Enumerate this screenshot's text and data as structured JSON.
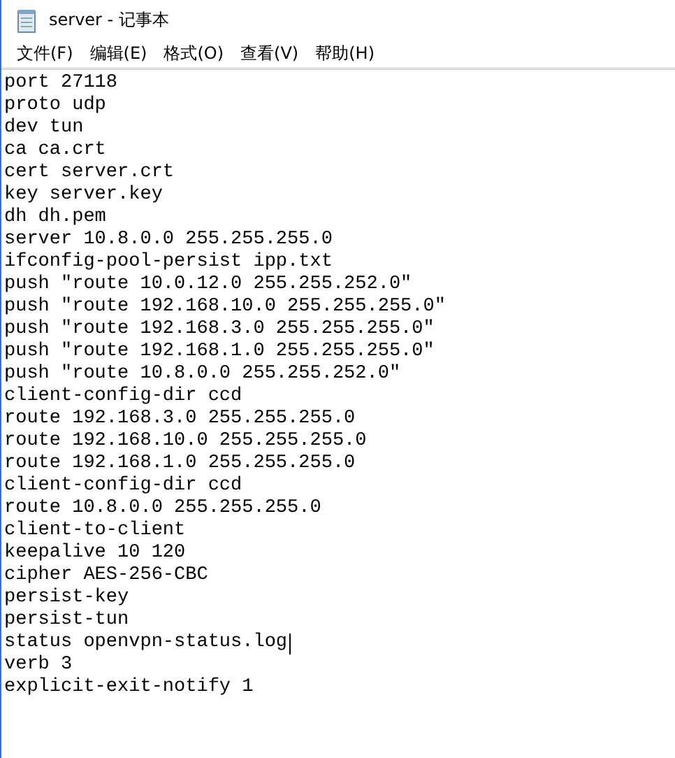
{
  "window": {
    "title": "server - 记事本"
  },
  "menu": [
    "文件(F)",
    "编辑(E)",
    "格式(O)",
    "查看(V)",
    "帮助(H)"
  ],
  "editor": {
    "lines": [
      {
        "text": "port 27118",
        "cursor": false
      },
      {
        "text": "proto udp",
        "cursor": false
      },
      {
        "text": "dev tun",
        "cursor": false
      },
      {
        "text": "ca ca.crt",
        "cursor": false
      },
      {
        "text": "cert server.crt",
        "cursor": false
      },
      {
        "text": "key server.key",
        "cursor": false
      },
      {
        "text": "dh dh.pem",
        "cursor": false
      },
      {
        "text": "server 10.8.0.0 255.255.255.0",
        "cursor": false
      },
      {
        "text": "ifconfig-pool-persist ipp.txt",
        "cursor": false
      },
      {
        "text": "push \"route 10.0.12.0 255.255.252.0\"",
        "cursor": false
      },
      {
        "text": "push \"route 192.168.10.0 255.255.255.0\"",
        "cursor": false
      },
      {
        "text": "push \"route 192.168.3.0 255.255.255.0\"",
        "cursor": false
      },
      {
        "text": "push \"route 192.168.1.0 255.255.255.0\"",
        "cursor": false
      },
      {
        "text": "push \"route 10.8.0.0 255.255.252.0\"",
        "cursor": false
      },
      {
        "text": "client-config-dir ccd",
        "cursor": false
      },
      {
        "text": "route 192.168.3.0 255.255.255.0",
        "cursor": false
      },
      {
        "text": "route 192.168.10.0 255.255.255.0",
        "cursor": false
      },
      {
        "text": "route 192.168.1.0 255.255.255.0",
        "cursor": false
      },
      {
        "text": "client-config-dir ccd",
        "cursor": false
      },
      {
        "text": "route 10.8.0.0 255.255.255.0",
        "cursor": false
      },
      {
        "text": "client-to-client",
        "cursor": false
      },
      {
        "text": "keepalive 10 120",
        "cursor": false
      },
      {
        "text": "cipher AES-256-CBC",
        "cursor": false
      },
      {
        "text": "persist-key",
        "cursor": false
      },
      {
        "text": "persist-tun",
        "cursor": false
      },
      {
        "text": "status openvpn-status.log",
        "cursor": true
      },
      {
        "text": "verb 3",
        "cursor": false
      },
      {
        "text": "explicit-exit-notify 1",
        "cursor": false
      }
    ]
  }
}
